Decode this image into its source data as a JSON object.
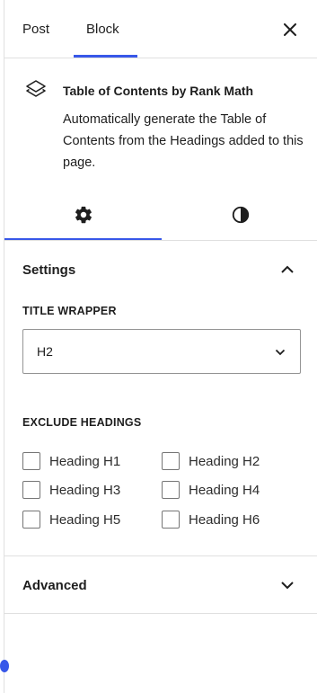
{
  "tabs": {
    "post_label": "Post",
    "block_label": "Block",
    "active": "Block"
  },
  "block": {
    "title": "Table of Contents by Rank Math",
    "description": "Automatically generate the Table of Contents from the Headings added to this page."
  },
  "inner_tabs": [
    {
      "icon": "gear-icon",
      "active": true
    },
    {
      "icon": "contrast-icon",
      "active": false
    }
  ],
  "settings": {
    "title": "Settings",
    "expanded": true,
    "title_wrapper": {
      "label": "TITLE WRAPPER",
      "value": "H2"
    },
    "exclude_headings": {
      "label": "EXCLUDE HEADINGS",
      "options": [
        {
          "label": "Heading H1",
          "checked": false
        },
        {
          "label": "Heading H2",
          "checked": false
        },
        {
          "label": "Heading H3",
          "checked": false
        },
        {
          "label": "Heading H4",
          "checked": false
        },
        {
          "label": "Heading H5",
          "checked": false
        },
        {
          "label": "Heading H6",
          "checked": false
        }
      ]
    }
  },
  "advanced": {
    "title": "Advanced",
    "expanded": false
  },
  "colors": {
    "accent": "#3858e9",
    "text": "#1e1e1e",
    "border": "#e0e0e0"
  }
}
